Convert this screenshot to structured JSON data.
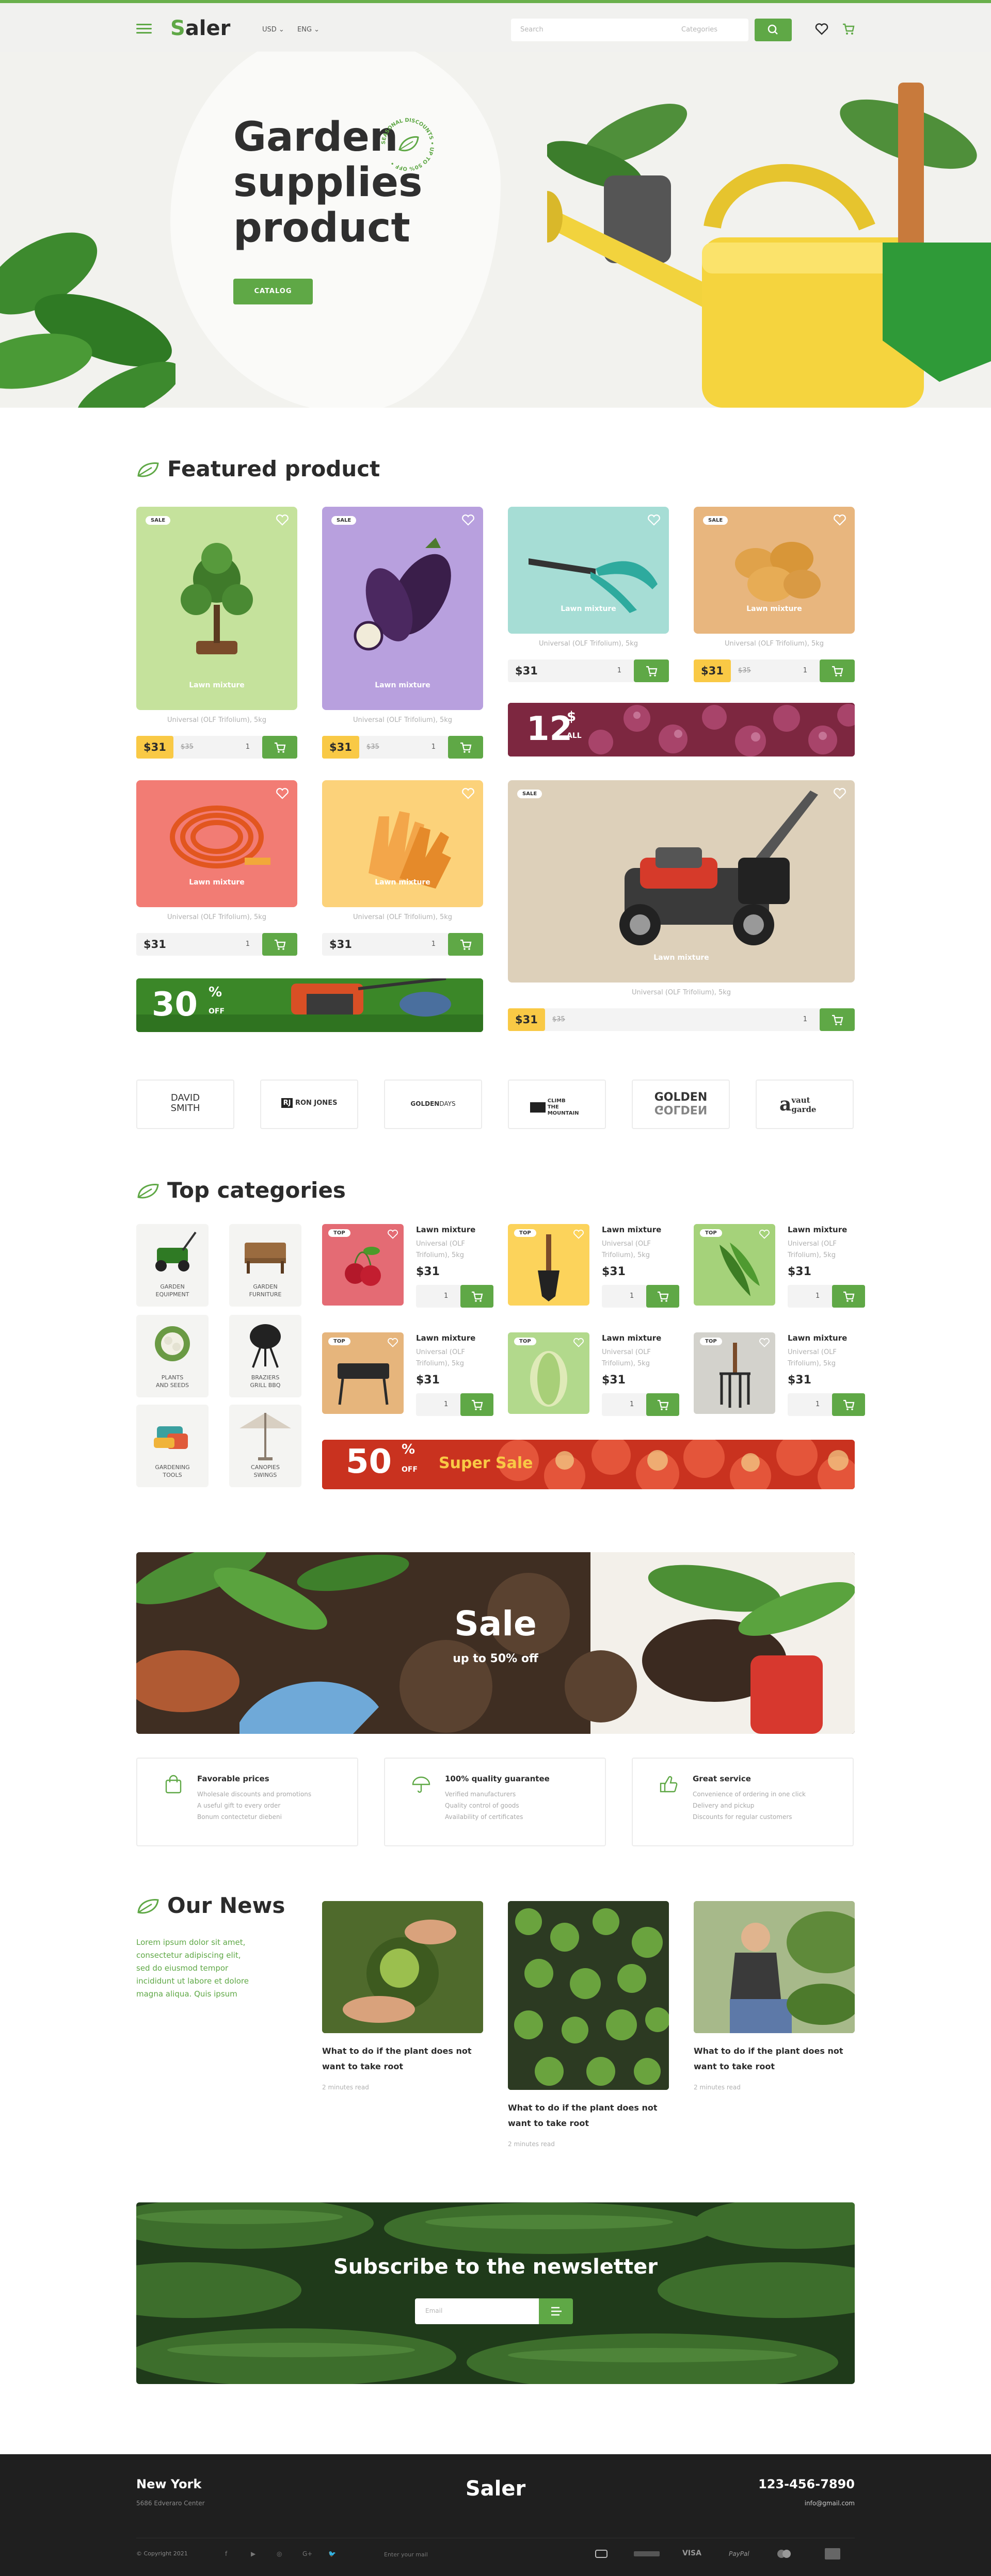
{
  "header": {
    "logo_first": "S",
    "logo_rest": "aler",
    "currency": "USD ⌄",
    "language": "ENG ⌄",
    "search_placeholder": "Search",
    "category_select": "Categories",
    "menu_icon": "menu-icon",
    "wishlist_icon": "heart-icon",
    "cart_icon": "cart-icon"
  },
  "hero": {
    "title_l1": "Garden",
    "title_l2": "supplies",
    "title_l3": "product",
    "seal_text": "SEASONAL DISCOUNTS • UP TO 50% OFF •",
    "button": "CATALOG",
    "slides": 3
  },
  "featured": {
    "title": "Featured product",
    "products": [
      {
        "tag": "SALE",
        "label": "Lawn mixture",
        "desc": "Universal (OLF Trifolium), 5kg",
        "price": "$31",
        "old": "$35",
        "qty": "1",
        "color": "#c5e29c"
      },
      {
        "tag": "SALE",
        "label": "Lawn mixture",
        "desc": "Universal (OLF Trifolium), 5kg",
        "price": "$31",
        "old": "$35",
        "qty": "1",
        "color": "#b8a0de"
      },
      {
        "tag": "",
        "label": "Lawn mixture",
        "desc": "Universal (OLF Trifolium), 5kg",
        "price": "$31",
        "old": "",
        "qty": "1",
        "color": "#a6ddd5"
      },
      {
        "tag": "SALE",
        "label": "Lawn mixture",
        "desc": "Universal (OLF Trifolium), 5kg",
        "price": "$31",
        "old": "$35",
        "qty": "1",
        "color": "#e8b67e"
      },
      {
        "tag": "",
        "label": "Lawn mixture",
        "desc": "Universal (OLF Trifolium), 5kg",
        "price": "$31",
        "old": "",
        "qty": "1",
        "color": "#f27c74"
      },
      {
        "tag": "",
        "label": "Lawn mixture",
        "desc": "Universal (OLF Trifolium), 5kg",
        "price": "$31",
        "old": "",
        "qty": "1",
        "color": "#fcd27a"
      },
      {
        "tag": "SALE",
        "label": "Lawn mixture",
        "desc": "Universal (OLF Trifolium), 5kg",
        "price": "$31",
        "old": "$35",
        "qty": "1",
        "color": "#ddd0ba"
      }
    ],
    "banner1_big": "12",
    "banner1_sym": "$",
    "banner1_small": "ALL",
    "banner2_big": "30",
    "banner2_sym": "%",
    "banner2_small": "OFF"
  },
  "brands": [
    {
      "l1": "DAVID",
      "l2": "SMITH"
    },
    {
      "l1": "RJ",
      "l2": "RON JONES"
    },
    {
      "l1": "GOLDEN",
      "l2": "DAYS"
    },
    {
      "l1": "CLIMB",
      "l2": "THE MOUNTAIN"
    },
    {
      "l1": "GOLDEN",
      "l2": "GOLDEN"
    },
    {
      "l1": "vaut",
      "l2": "garde"
    }
  ],
  "top_categories": {
    "title": "Top categories",
    "categories": [
      {
        "l1": "GARDEN",
        "l2": "EQUIPMENT"
      },
      {
        "l1": "GARDEN",
        "l2": "FURNITURE"
      },
      {
        "l1": "PLANTS",
        "l2": "AND SEEDS"
      },
      {
        "l1": "BRAZIERS",
        "l2": "GRILL BBQ"
      },
      {
        "l1": "GARDENING",
        "l2": "TOOLS"
      },
      {
        "l1": "CANOPIES",
        "l2": "SWINGS"
      }
    ],
    "products": [
      {
        "tag": "TOP",
        "name": "Lawn mixture",
        "desc": "Universal (OLF Trifolium), 5kg",
        "price": "$31",
        "qty": "1",
        "color": "#e46b74"
      },
      {
        "tag": "TOP",
        "name": "Lawn mixture",
        "desc": "Universal (OLF Trifolium), 5kg",
        "price": "$31",
        "qty": "1",
        "color": "#fcd35b"
      },
      {
        "tag": "TOP",
        "name": "Lawn mixture",
        "desc": "Universal (OLF Trifolium), 5kg",
        "price": "$31",
        "qty": "1",
        "color": "#a5d27a"
      },
      {
        "tag": "TOP",
        "name": "Lawn mixture",
        "desc": "Universal (OLF Trifolium), 5kg",
        "price": "$31",
        "qty": "1",
        "color": "#e6b57c"
      },
      {
        "tag": "TOP",
        "name": "Lawn mixture",
        "desc": "Universal (OLF Trifolium), 5kg",
        "price": "$31",
        "qty": "1",
        "color": "#b2d98c"
      },
      {
        "tag": "TOP",
        "name": "Lawn mixture",
        "desc": "Universal (OLF Trifolium), 5kg",
        "price": "$31",
        "qty": "1",
        "color": "#d3d2cc"
      }
    ],
    "banner_big": "50",
    "banner_sym": "%",
    "banner_small": "OFF",
    "banner_text": "Super Sale"
  },
  "sale_banner": {
    "title": "Sale",
    "subtitle": "up to 50% off"
  },
  "features": [
    {
      "title": "Favorable prices",
      "lines": [
        "Wholesale discounts and promotions",
        "A useful gift to every order",
        "Bonum contectetur diebeni"
      ]
    },
    {
      "title": "100% quality guarantee",
      "lines": [
        "Verified manufacturers",
        "Quality control of goods",
        "Availability of certificates"
      ]
    },
    {
      "title": "Great service",
      "lines": [
        "Convenience of ordering in one click",
        "Delivery and pickup",
        "Discounts for regular customers"
      ]
    }
  ],
  "news": {
    "title": "Our News",
    "intro": "Lorem ipsum dolor sit amet, consectetur adipiscing elit, sed do eiusmod tempor incididunt ut labore et dolore magna aliqua. Quis ipsum",
    "items": [
      {
        "title": "What to do if the plant does not want to take root",
        "meta": "2 minutes read"
      },
      {
        "title": "What to do if the plant does not want to take root",
        "meta": "2 minutes read"
      },
      {
        "title": "What to do if the plant does not want to take root",
        "meta": "2 minutes read"
      }
    ]
  },
  "newsletter": {
    "title": "Subscribe to the newsletter",
    "placeholder": "Email"
  },
  "footer": {
    "city": "New York",
    "address": "5686 Edveraro Center",
    "logo": "Saler",
    "phone": "123-456-7890",
    "email": "info@gmail.com",
    "copyright": "© Copyright 2021",
    "social": [
      "f",
      "▶",
      "◎",
      "G+",
      "🐦"
    ],
    "email_placeholder": "Enter your mail",
    "payments": [
      "VISA",
      "PayPal"
    ]
  },
  "colors": {
    "accent": "#5fa846",
    "yellow": "#f9c945",
    "dark": "#1f1f1f"
  }
}
